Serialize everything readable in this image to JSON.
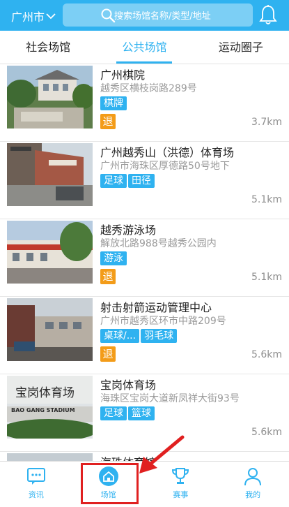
{
  "header": {
    "city": "广州市",
    "search_placeholder": "搜索场馆名称/类型/地址"
  },
  "tabs": [
    {
      "label": "社会场馆",
      "active": false
    },
    {
      "label": "公共场馆",
      "active": true
    },
    {
      "label": "运动圈子",
      "active": false
    }
  ],
  "venues": [
    {
      "name": "广州棋院",
      "address": "越秀区横枝岗路289号",
      "tags": [
        "棋牌"
      ],
      "refund": "退",
      "distance": "3.7km"
    },
    {
      "name": "广州越秀山（洪德）体育场",
      "address": "广州市海珠区厚德路50号地下",
      "tags": [
        "足球",
        "田径"
      ],
      "refund": "",
      "distance": "5.1km"
    },
    {
      "name": "越秀游泳场",
      "address": "解放北路988号越秀公园内",
      "tags": [
        "游泳"
      ],
      "refund": "退",
      "distance": "5.1km"
    },
    {
      "name": "射击射箭运动管理中心",
      "address": "广州市越秀区环市中路209号",
      "tags": [
        "桌球/...",
        "羽毛球"
      ],
      "refund": "退",
      "distance": "5.6km"
    },
    {
      "name": "宝岗体育场",
      "address": "海珠区宝岗大道新凤祥大街93号",
      "tags": [
        "足球",
        "篮球"
      ],
      "refund": "",
      "distance": "5.6km"
    },
    {
      "name": "海珠体育馆",
      "address": "",
      "tags": [],
      "refund": "",
      "distance": ""
    }
  ],
  "thumb_texts": {
    "baogang_cn": "宝岗体育场",
    "baogang_en": "BAO GANG STADIUM"
  },
  "bottom_nav": [
    {
      "label": "资讯",
      "icon": "chat-icon"
    },
    {
      "label": "场馆",
      "icon": "home-icon",
      "active": true
    },
    {
      "label": "赛事",
      "icon": "trophy-icon"
    },
    {
      "label": "我的",
      "icon": "person-icon"
    }
  ],
  "colors": {
    "primary": "#2fb2f0",
    "refund": "#f39c19",
    "annotation": "#e02020"
  }
}
